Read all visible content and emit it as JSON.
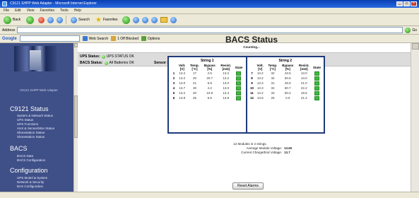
{
  "window": {
    "title": "C9121 SHPP Web Adapter - Microsoft Internet Explorer"
  },
  "menubar": [
    "File",
    "Edit",
    "View",
    "Favorites",
    "Tools",
    "Help"
  ],
  "toolbar": {
    "back": "Back",
    "search": "Search",
    "favorites": "Favorites"
  },
  "address": {
    "label": "Address",
    "go": "Go"
  },
  "googlebar": {
    "logo": "Google",
    "btn1": "Web Search",
    "btn2": "1 Off Blocked",
    "btn3": "Options"
  },
  "nav": {
    "model": "C9121 SHPP Web Adapter",
    "sections": [
      {
        "heading": "C9121 Status",
        "items": [
          "System & Network Status",
          "UPS Status",
          "UPS Functions",
          "AUX & Sensor/Mon Status",
          "Shorestation Status",
          "Shorestation Status"
        ]
      },
      {
        "heading": "BACS",
        "items": [
          "BACS Data",
          "BACS Configuration"
        ]
      },
      {
        "heading": "Configuration",
        "items": [
          "UPS Model & System",
          "Network & Security",
          "BAS Configuration"
        ]
      }
    ]
  },
  "status_band": {
    "ups_label": "UPS Status:",
    "ups_value": "UPS STATUS OK",
    "bacs_label": "BACS Status:",
    "bacs_value": "All Batteries OK",
    "sensor_label": "Sensor Status:"
  },
  "main": {
    "title": "BACS Status",
    "subtitle": "Counting..."
  },
  "strings": [
    {
      "title": "String 1",
      "headers": [
        "",
        "Volt. [V]",
        "Temp. [°C]",
        "Bypass [%]",
        "Resist. [mΩ]",
        "State"
      ],
      "rows": [
        [
          "1",
          "13.2",
          "17",
          "2.5",
          "13.2"
        ],
        [
          "2",
          "13.2",
          "20",
          "20.7",
          "13.2"
        ],
        [
          "3",
          "13.0",
          "21",
          "6.9",
          "13.0"
        ],
        [
          "4",
          "13.7",
          "30",
          "4.2",
          "13.0"
        ],
        [
          "5",
          "13.2",
          "20",
          "10.9",
          "13.4"
        ],
        [
          "6",
          "13.8",
          "25",
          "6.9",
          "13.8"
        ]
      ]
    },
    {
      "title": "String 2",
      "headers": [
        "",
        "Volt. [V]",
        "Temp. [°C]",
        "Bypass [%]",
        "Resist. [mΩ]",
        "State"
      ],
      "rows": [
        [
          "7",
          "13.2",
          "32",
          "43.5",
          "13.0"
        ],
        [
          "8",
          "13.2",
          "32",
          "60.6",
          "13.0"
        ],
        [
          "9",
          "13.3",
          "31",
          "45.6",
          "21.0"
        ],
        [
          "10",
          "13.3",
          "32",
          "60.7",
          "22.2"
        ],
        [
          "11",
          "13.2",
          "33",
          "50.2",
          "19.6"
        ],
        [
          "12",
          "13.8",
          "25",
          "0.0",
          "21.2"
        ]
      ]
    }
  ],
  "summary": {
    "modules": "12 Modules in 2 strings.",
    "avg_label": "Average Module Voltage:",
    "avg_value": "13.60",
    "current_label": "Current Charge/End Voltage:",
    "current_value": "13.7"
  },
  "reset_button": "Reset Alarms",
  "colors": {
    "nav_bg": "#3f4f87",
    "string_border": "#1f3b7a",
    "state_ok": "#3cbb3c"
  }
}
